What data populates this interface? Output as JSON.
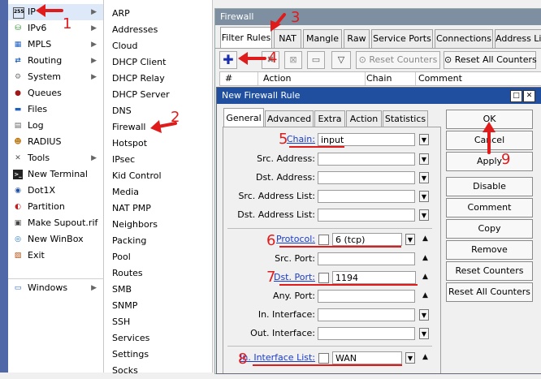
{
  "menu_primary": [
    {
      "label": "IP",
      "icon": "ip-icon",
      "submenu": true
    },
    {
      "label": "IPv6",
      "icon": "ipv6-icon",
      "submenu": true
    },
    {
      "label": "MPLS",
      "icon": "mpls-icon",
      "submenu": true
    },
    {
      "label": "Routing",
      "icon": "routing-icon",
      "submenu": true
    },
    {
      "label": "System",
      "icon": "system-icon",
      "submenu": true
    },
    {
      "label": "Queues",
      "icon": "queues-icon",
      "submenu": false
    },
    {
      "label": "Files",
      "icon": "files-icon",
      "submenu": false
    },
    {
      "label": "Log",
      "icon": "log-icon",
      "submenu": false
    },
    {
      "label": "RADIUS",
      "icon": "radius-icon",
      "submenu": false
    },
    {
      "label": "Tools",
      "icon": "tools-icon",
      "submenu": true
    },
    {
      "label": "New Terminal",
      "icon": "terminal-icon",
      "submenu": false
    },
    {
      "label": "Dot1X",
      "icon": "dot1x-icon",
      "submenu": false
    },
    {
      "label": "Partition",
      "icon": "partition-icon",
      "submenu": false
    },
    {
      "label": "Make Supout.rif",
      "icon": "supout-icon",
      "submenu": false
    },
    {
      "label": "New WinBox",
      "icon": "winbox-icon",
      "submenu": false
    },
    {
      "label": "Exit",
      "icon": "exit-icon",
      "submenu": false
    },
    {
      "label": "Windows",
      "icon": "windows-icon",
      "submenu": true
    }
  ],
  "menu_ip": [
    "ARP",
    "Addresses",
    "Cloud",
    "DHCP Client",
    "DHCP Relay",
    "DHCP Server",
    "DNS",
    "Firewall",
    "Hotspot",
    "IPsec",
    "Kid Control",
    "Media",
    "NAT PMP",
    "Neighbors",
    "Packing",
    "Pool",
    "Routes",
    "SMB",
    "SNMP",
    "SSH",
    "Services",
    "Settings",
    "Socks"
  ],
  "firewall": {
    "title": "Firewall",
    "tabs": [
      "Filter Rules",
      "NAT",
      "Mangle",
      "Raw",
      "Service Ports",
      "Connections",
      "Address Lis"
    ],
    "toolbar": {
      "reset_counters": "Reset Counters",
      "reset_all_counters": "Reset All Counters"
    },
    "columns": [
      "#",
      "Action",
      "Chain",
      "Comment"
    ]
  },
  "dialog": {
    "title": "New Firewall Rule",
    "tabs": [
      "General",
      "Advanced",
      "Extra",
      "Action",
      "Statistics"
    ],
    "fields": {
      "chain": {
        "label": "Chain:",
        "value": "input"
      },
      "src_address": {
        "label": "Src. Address:",
        "value": ""
      },
      "dst_address": {
        "label": "Dst. Address:",
        "value": ""
      },
      "src_address_list": {
        "label": "Src. Address List:",
        "value": ""
      },
      "dst_address_list": {
        "label": "Dst. Address List:",
        "value": ""
      },
      "protocol": {
        "label": "Protocol:",
        "value": "6 (tcp)"
      },
      "src_port": {
        "label": "Src. Port:",
        "value": ""
      },
      "dst_port": {
        "label": "Dst. Port:",
        "value": "1194"
      },
      "any_port": {
        "label": "Any. Port:",
        "value": ""
      },
      "in_interface": {
        "label": "In. Interface:",
        "value": ""
      },
      "out_interface": {
        "label": "Out. Interface:",
        "value": ""
      },
      "in_interface_list": {
        "label": "In. Interface List:",
        "value": "WAN"
      }
    },
    "buttons": [
      "OK",
      "Cancel",
      "Apply",
      "Disable",
      "Comment",
      "Copy",
      "Remove",
      "Reset Counters",
      "Reset All Counters"
    ]
  },
  "annotations": [
    "1",
    "2",
    "3",
    "4",
    "5",
    "6",
    "7",
    "8",
    "9"
  ],
  "colors": {
    "annotation": "#e01b1b",
    "dialog_title_bg": "#1f4f9e",
    "link": "#1a3cc8"
  }
}
